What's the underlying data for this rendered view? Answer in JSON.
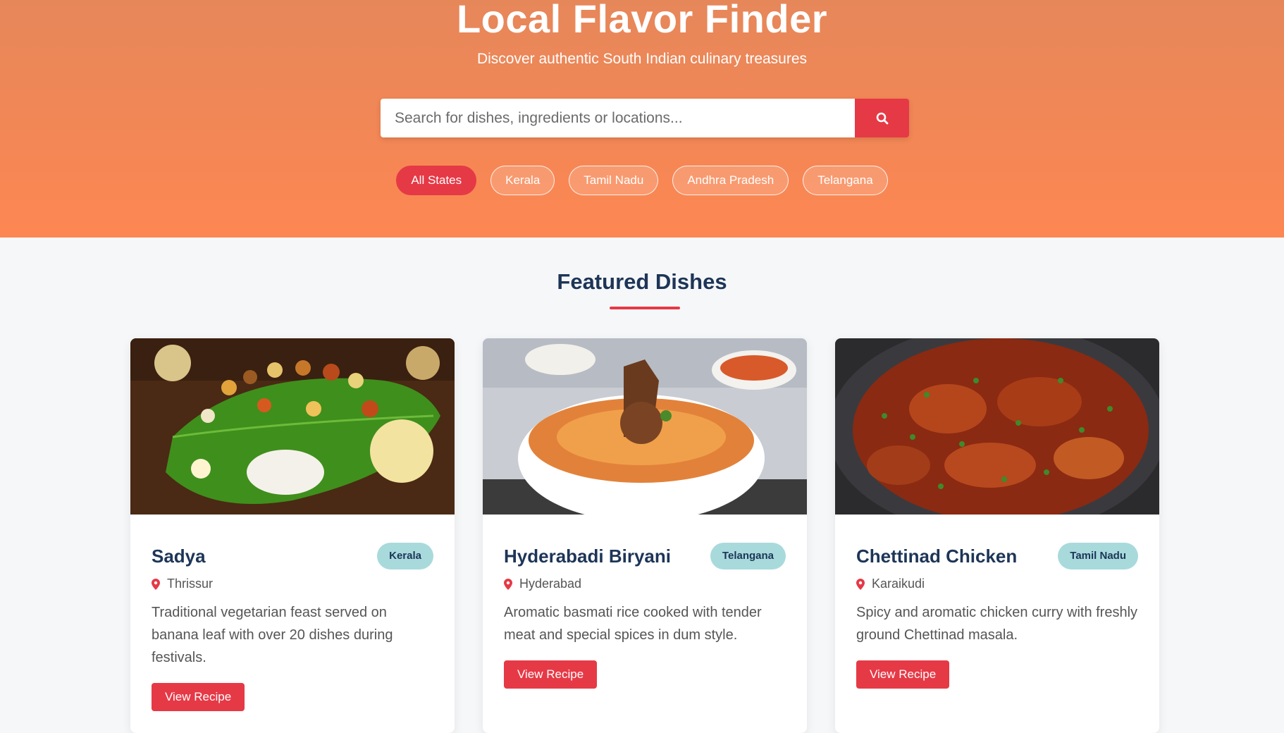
{
  "hero": {
    "title": "Local Flavor Finder",
    "subtitle": "Discover authentic South Indian culinary treasures"
  },
  "search": {
    "placeholder": "Search for dishes, ingredients or locations...",
    "value": "",
    "button_icon": "search-icon"
  },
  "filters": [
    "All States",
    "Kerala",
    "Tamil Nadu",
    "Andhra Pradesh",
    "Telangana"
  ],
  "active_filter": "All States",
  "featured": {
    "title": "Featured Dishes"
  },
  "dishes": [
    {
      "name": "Sadya",
      "state": "Kerala",
      "location": "Thrissur",
      "description": "Traditional vegetarian feast served on banana leaf with over 20 dishes during festivals.",
      "button": "View Recipe"
    },
    {
      "name": "Hyderabadi Biryani",
      "state": "Telangana",
      "location": "Hyderabad",
      "description": "Aromatic basmati rice cooked with tender meat and special spices in dum style.",
      "button": "View Recipe"
    },
    {
      "name": "Chettinad Chicken",
      "state": "Tamil Nadu",
      "location": "Karaikudi",
      "description": "Spicy and aromatic chicken curry with freshly ground Chettinad masala.",
      "button": "View Recipe"
    }
  ],
  "colors": {
    "accent": "#e63946",
    "heading": "#1d3557",
    "badge": "#a8dadc",
    "hero_top": "#e6875a",
    "hero_bottom": "#fd8753"
  }
}
